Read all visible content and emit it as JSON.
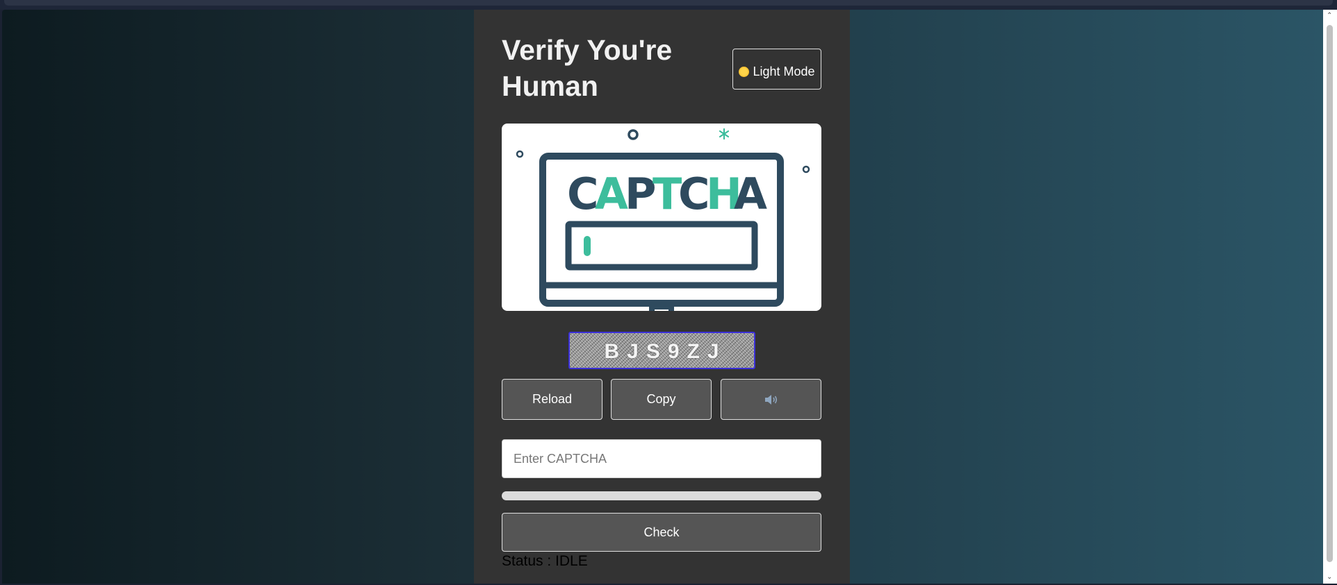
{
  "page": {
    "title": "Verify You're Human",
    "theme_toggle": {
      "icon": "sun-icon",
      "label": "Light Mode"
    }
  },
  "illustration": {
    "word": "CAPTCHA",
    "colors": {
      "dark": "#2e4a5e",
      "accent": "#3dbd9c"
    }
  },
  "captcha": {
    "code": "BJS9ZJ"
  },
  "buttons": {
    "reload": "Reload",
    "copy": "Copy",
    "audio_icon": "speaker-icon"
  },
  "input": {
    "placeholder": "Enter CAPTCHA",
    "value": ""
  },
  "progress": {
    "value": 0
  },
  "check": {
    "label": "Check"
  },
  "status": {
    "text": "Status : IDLE"
  },
  "colors": {
    "card_bg": "#333333",
    "button_bg": "#555555",
    "captcha_border": "#3a2fd8"
  }
}
